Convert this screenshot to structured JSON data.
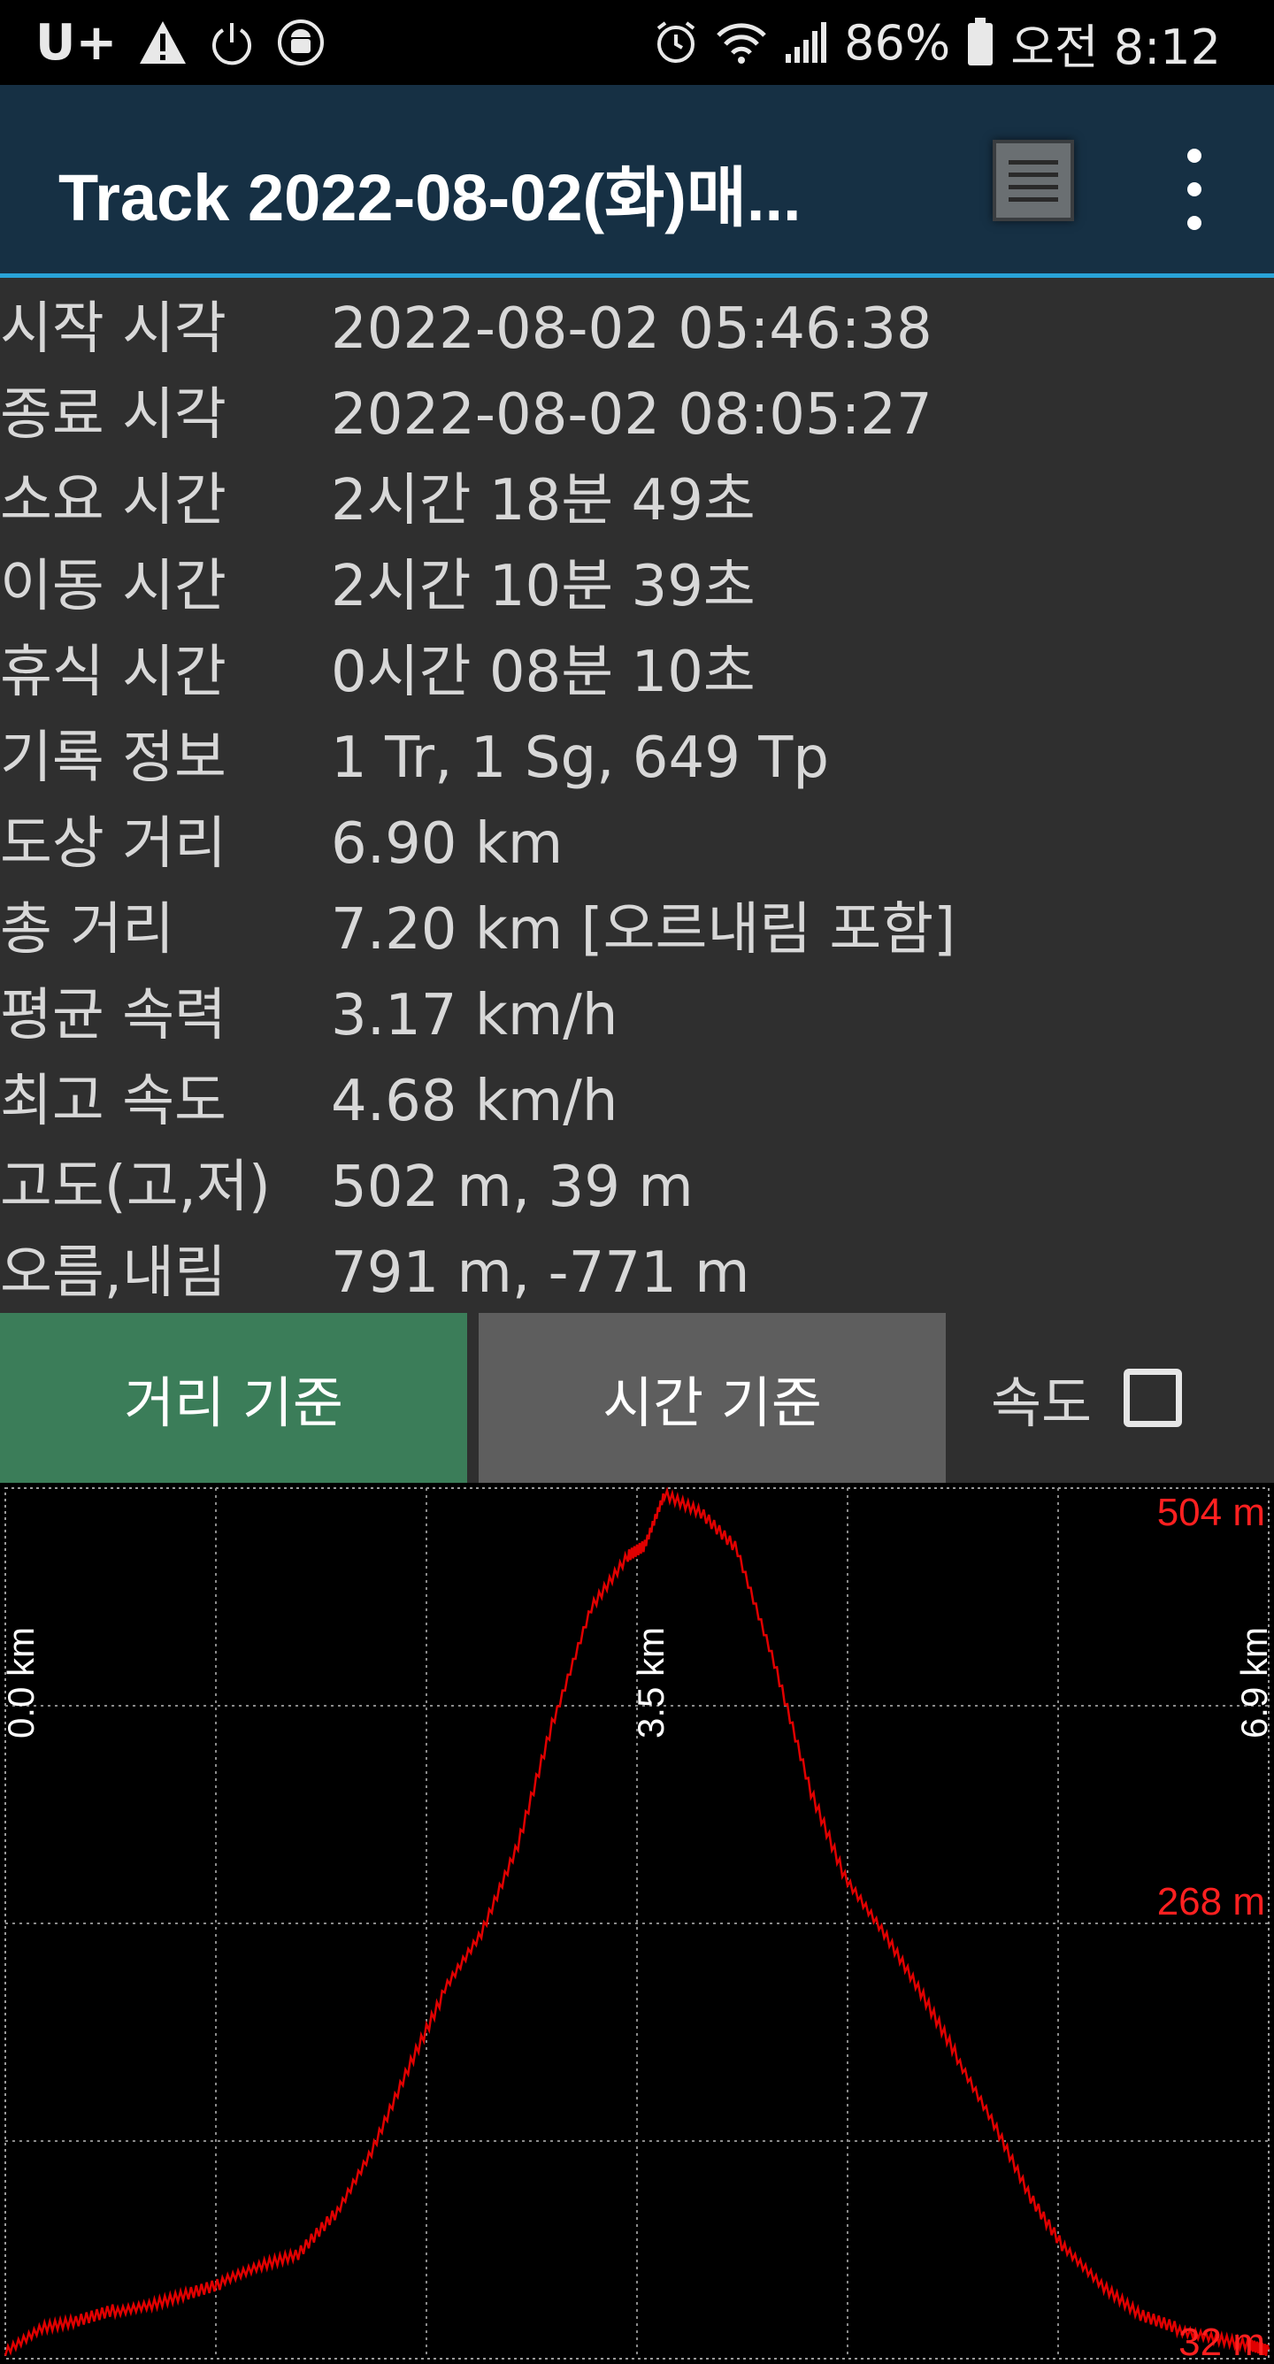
{
  "status_bar": {
    "carrier": "U+",
    "battery_percent": "86%",
    "time": "오전 8:12",
    "left_icons": [
      "warning-icon",
      "power-icon",
      "android-debug-icon"
    ],
    "right_icons": [
      "alarm-icon",
      "wifi-icon",
      "signal-icon",
      "battery-icon"
    ]
  },
  "app_bar": {
    "title": "Track 2022-08-02(화)매..."
  },
  "info_rows": [
    {
      "label": "시작 시각",
      "value": "2022-08-02 05:46:38"
    },
    {
      "label": "종료 시각",
      "value": "2022-08-02 08:05:27"
    },
    {
      "label": "소요 시간",
      "value": "2시간 18분 49초"
    },
    {
      "label": "이동 시간",
      "value": "2시간 10분 39초"
    },
    {
      "label": "휴식 시간",
      "value": "0시간 08분 10초"
    },
    {
      "label": "기록 정보",
      "value": "1 Tr, 1 Sg, 649 Tp"
    },
    {
      "label": "도상 거리",
      "value": "6.90 km"
    },
    {
      "label": "총 거리",
      "value": "7.20 km [오르내림 포함]"
    },
    {
      "label": "평균 속력",
      "value": "3.17 km/h"
    },
    {
      "label": "최고 속도",
      "value": "4.68 km/h"
    },
    {
      "label": "고도(고,저)",
      "value": "502 m, 39 m"
    },
    {
      "label": "오름,내림",
      "value": "791 m, -771 m"
    }
  ],
  "mode_buttons": {
    "distance": "거리 기준",
    "time": "시간 기준",
    "speed_label": "속도",
    "speed_checked": false
  },
  "chart_data": {
    "type": "line",
    "line_color": "#e00000",
    "grid": true,
    "x_tick_labels": [
      "0.0 km",
      "3.5 km",
      "6.9 km"
    ],
    "y_tick_labels": [
      "504 m",
      "268 m",
      "32 m"
    ],
    "xlim": [
      0,
      6.9
    ],
    "ylim": [
      32,
      504
    ],
    "series": [
      {
        "x": [
          0.0,
          0.2,
          0.4,
          0.6,
          0.8,
          1.0,
          1.2,
          1.4,
          1.6,
          1.8,
          2.0,
          2.2,
          2.4,
          2.6,
          2.8,
          3.0,
          3.2,
          3.4,
          3.5,
          3.6,
          3.8,
          4.0,
          4.2,
          4.4,
          4.6,
          4.8,
          5.0,
          5.2,
          5.4,
          5.6,
          5.8,
          6.0,
          6.2,
          6.4,
          6.6,
          6.8,
          6.9
        ],
        "y": [
          35,
          48,
          52,
          58,
          62,
          68,
          74,
          82,
          88,
          110,
          145,
          190,
          232,
          262,
          310,
          380,
          440,
          468,
          474,
          500,
          490,
          470,
          410,
          340,
          290,
          262,
          230,
          195,
          160,
          120,
          90,
          70,
          55,
          48,
          44,
          40,
          37
        ]
      }
    ]
  }
}
